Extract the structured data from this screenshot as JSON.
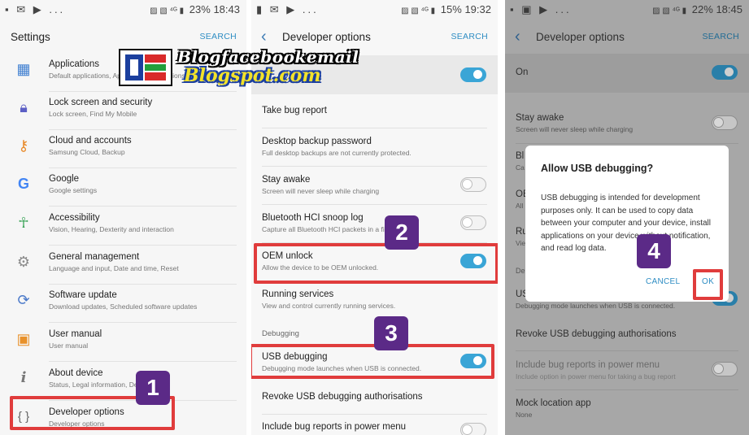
{
  "panel1": {
    "status": {
      "left_icons": "▪ ✉ ▶ ...",
      "right_icons": "▨ ▧ ⁴ᴳ ▮",
      "battery": "23%",
      "time": "18:43"
    },
    "title": "Settings",
    "search_label": "SEARCH",
    "items": [
      {
        "title": "Applications",
        "subtitle": "Default applications, Application permissions"
      },
      {
        "title": "Lock screen and security",
        "subtitle": "Lock screen, Find My Mobile"
      },
      {
        "title": "Cloud and accounts",
        "subtitle": "Samsung Cloud, Backup"
      },
      {
        "title": "Google",
        "subtitle": "Google settings"
      },
      {
        "title": "Accessibility",
        "subtitle": "Vision, Hearing, Dexterity and interaction"
      },
      {
        "title": "General management",
        "subtitle": "Language and input, Date and time, Reset"
      },
      {
        "title": "Software update",
        "subtitle": "Download updates, Scheduled software updates"
      },
      {
        "title": "User manual",
        "subtitle": "User manual"
      },
      {
        "title": "About device",
        "subtitle": "Status, Legal information, Device name"
      },
      {
        "title": "Developer options",
        "subtitle": "Developer options"
      }
    ],
    "step_badge": "1"
  },
  "panel2": {
    "status": {
      "left_icons": "▮ ✉ ▶ ...",
      "right_icons": "▨ ▧ ⁴ᴳ ▮",
      "battery": "15%",
      "time": "19:32"
    },
    "title": "Developer options",
    "search_label": "SEARCH",
    "items": [
      {
        "title": "Take bug report",
        "subtitle": ""
      },
      {
        "title": "Desktop backup password",
        "subtitle": "Full desktop backups are not currently protected."
      },
      {
        "title": "Stay awake",
        "subtitle": "Screen will never sleep while charging"
      },
      {
        "title": "Bluetooth HCI snoop log",
        "subtitle": "Capture all Bluetooth HCI packets in a file"
      },
      {
        "title": "OEM unlock",
        "subtitle": "Allow the device to be OEM unlocked."
      },
      {
        "title": "Running services",
        "subtitle": "View and control currently running services."
      },
      {
        "title": "USB debugging",
        "subtitle": "Debugging mode launches when USB is connected."
      },
      {
        "title": "Revoke USB debugging authorisations",
        "subtitle": ""
      },
      {
        "title": "Include bug reports in power menu",
        "subtitle": ""
      }
    ],
    "section_debugging": "Debugging",
    "step_badge_oem": "2",
    "step_badge_usb": "3"
  },
  "panel3": {
    "status": {
      "left_icons": "▪ ▣ ▶ ...",
      "right_icons": "▨ ▧ ⁴ᴳ ▮",
      "battery": "22%",
      "time": "18:45"
    },
    "title": "Developer options",
    "search_label": "SEARCH",
    "on_label": "On",
    "items": [
      {
        "title": "Stay awake",
        "subtitle": "Screen will never sleep while charging"
      },
      {
        "title": "Bl",
        "subtitle": "Ca"
      },
      {
        "title": "OE",
        "subtitle": "All"
      },
      {
        "title": "Ru",
        "subtitle": "Vie"
      },
      {
        "title": "De",
        "subtitle": ""
      },
      {
        "title": "US",
        "subtitle": "Debugging mode launches when USB is connected."
      },
      {
        "title": "Revoke USB debugging authorisations",
        "subtitle": ""
      },
      {
        "title": "Include bug reports in power menu",
        "subtitle": "Include option in power menu for taking a bug report"
      },
      {
        "title": "Mock location app",
        "subtitle": "None"
      }
    ],
    "dialog": {
      "title": "Allow USB debugging?",
      "body": "USB debugging is intended for development purposes only. It can be used to copy data between your computer and your device, install applications on your device without notification, and read log data.",
      "cancel_label": "CANCEL",
      "ok_label": "OK"
    },
    "step_badge": "4"
  },
  "watermark": {
    "line1": "Blogfacebookemail",
    "line2": "Blogspot.com"
  },
  "colors": {
    "accent": "#3aa5d6",
    "callout": "#e03c3c",
    "badge": "#5b2a87",
    "link": "#2e8dc3"
  }
}
